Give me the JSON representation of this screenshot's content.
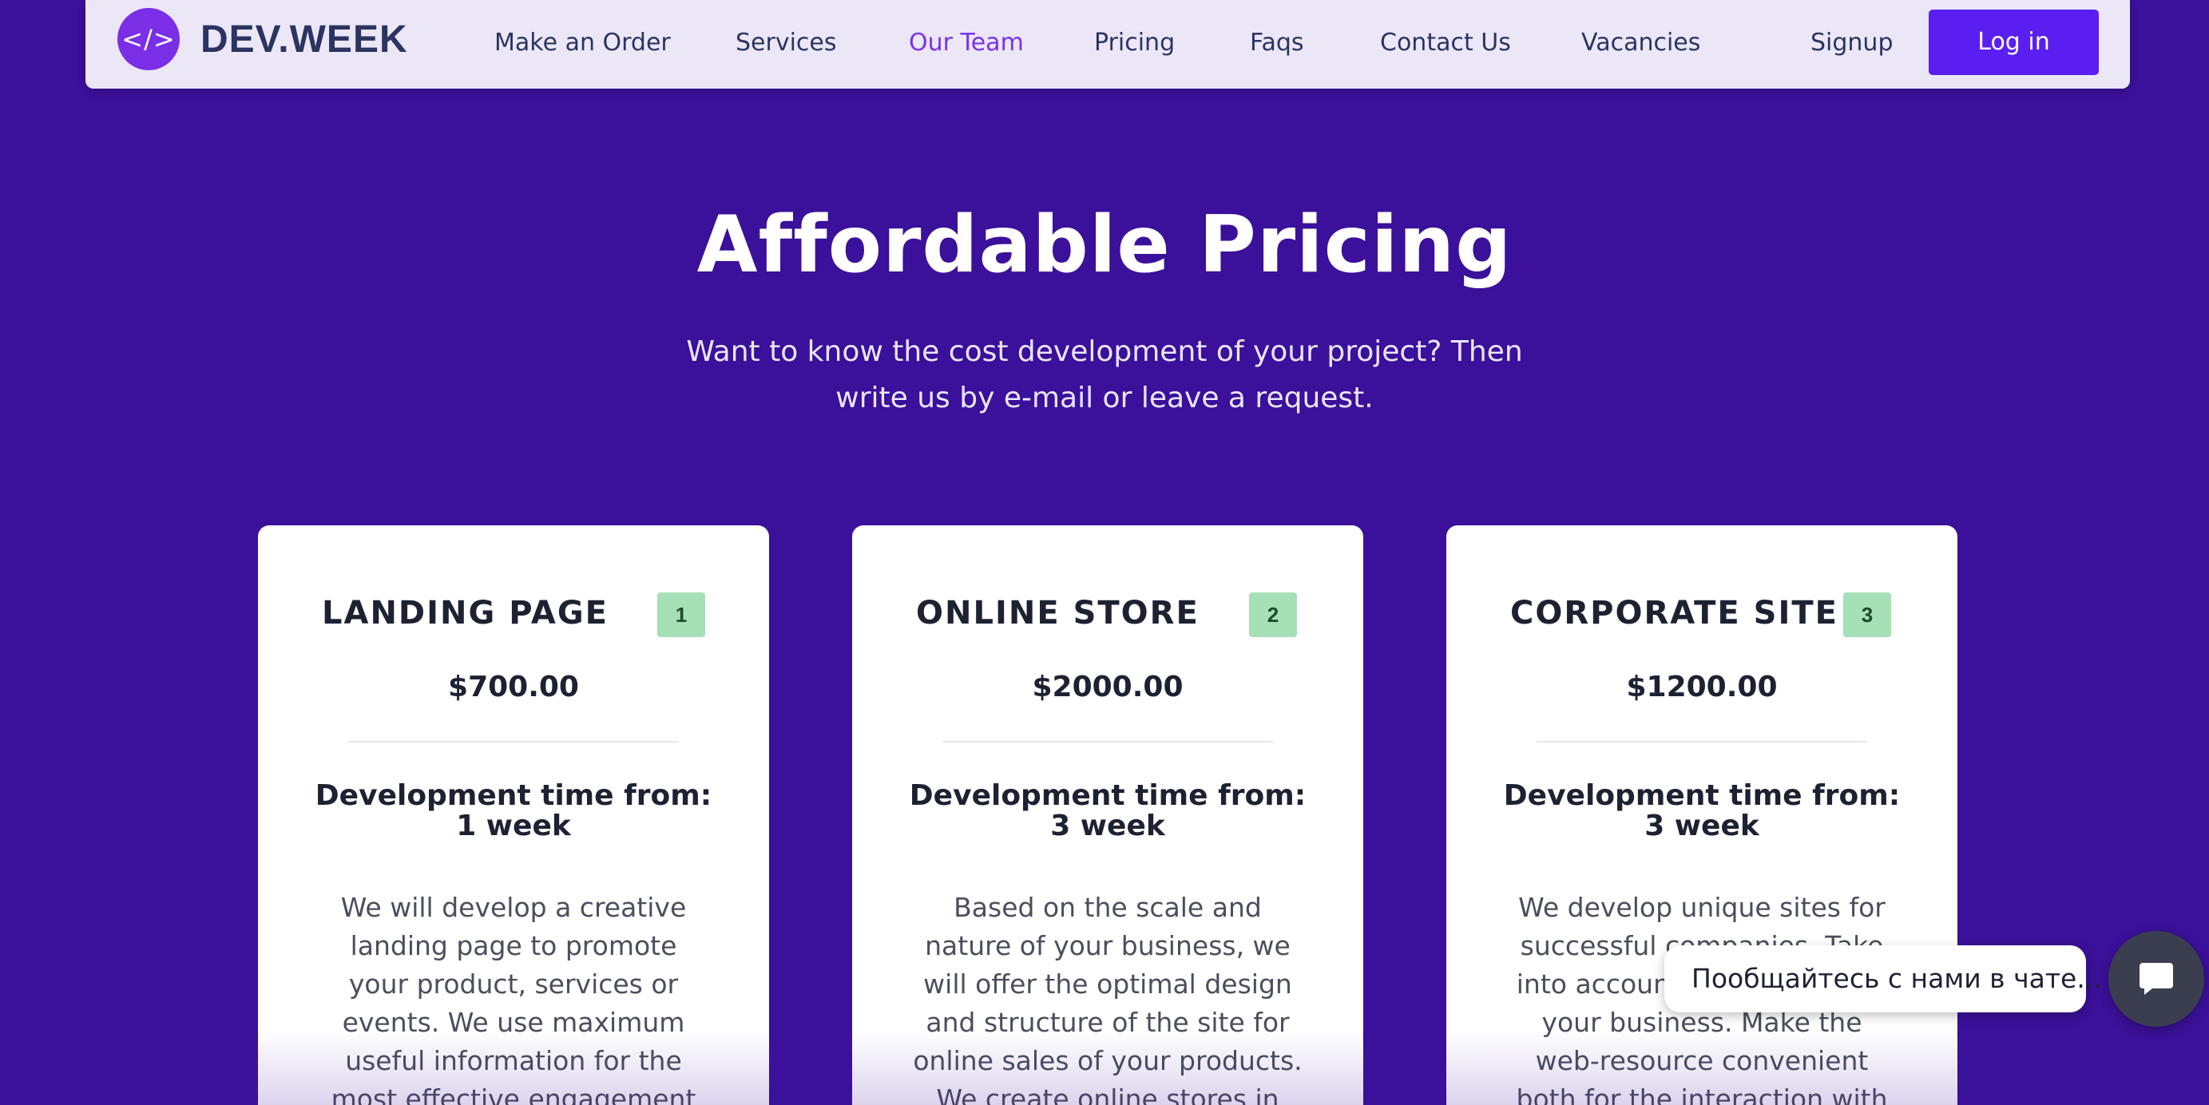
{
  "brand": {
    "logo_glyph": "</>",
    "name": "DEV.WEEK",
    "accent": "#7a2ee6"
  },
  "nav": {
    "items": [
      {
        "label": "Make an Order"
      },
      {
        "label": "Services"
      },
      {
        "label": "Our Team",
        "active": true
      },
      {
        "label": "Pricing"
      },
      {
        "label": "Faqs"
      },
      {
        "label": "Contact Us"
      },
      {
        "label": "Vacancies"
      }
    ],
    "signup_label": "Signup",
    "login_label": "Log in"
  },
  "hero": {
    "title": "Affordable Pricing",
    "subtitle": "Want to know the cost development of your project? Then write us by e-mail or leave a request."
  },
  "plans": [
    {
      "title": "LANDING PAGE",
      "badge": "1",
      "price": "$700.00",
      "devtime_label": "Development time from:",
      "devtime_value": "1 week",
      "description": "We will develop a creative landing page to promote your product, services or events. We use maximum useful information for the most effective engagement of your"
    },
    {
      "title": "ONLINE STORE",
      "badge": "2",
      "price": "$2000.00",
      "devtime_label": "Development time from:",
      "devtime_value": "3 week",
      "description": "Based on the scale and nature of your business, we will offer the optimal design and structure of the site for online sales of your products. We create online stores in which"
    },
    {
      "title": "CORPORATE SITE",
      "badge": "3",
      "price": "$1200.00",
      "devtime_label": "Development time from:",
      "devtime_value": "3 week",
      "description": "We develop unique sites for successful companies. Take into account the specifics of your business. Make the web-resource convenient both for the interaction with clients, and"
    }
  ],
  "chat": {
    "bubble_text": "Пообщайтесь с нами в чате...",
    "icon": "chat-icon"
  },
  "colors": {
    "background": "#3b109a",
    "nav_background": "#ebe7f6",
    "login_button": "#5a1ef0",
    "badge": "#a6e0b6",
    "active_link": "#7a33e8"
  }
}
